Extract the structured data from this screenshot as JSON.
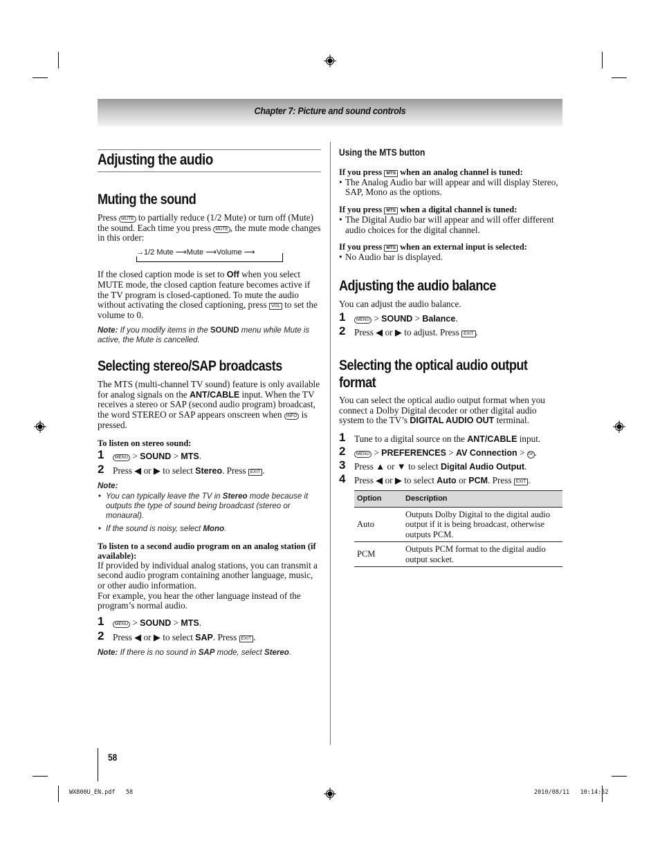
{
  "header": {
    "chapter_title": "Chapter 7: Picture and sound controls"
  },
  "left_column": {
    "page_title": "Adjusting the audio",
    "muting": {
      "heading": "Muting the sound",
      "p1_a": "Press",
      "p1_b": "to partially reduce (1/2 Mute) or turn off (Mute) the sound. Each time you press",
      "p1_c": ", the mute mode changes in this order:",
      "cycle": [
        "1/2 Mute",
        "Mute",
        "Volume"
      ],
      "p2_a": "If the closed caption mode is set to",
      "p2_bold": "Off",
      "p2_b": "when you select MUTE mode, the closed caption feature becomes active if the TV program is closed-captioned. To mute the audio without activating the closed captioning, press",
      "p2_c": "to set the volume to 0.",
      "note_label": "Note:",
      "note_a": "If you modify items in the",
      "note_bold": "SOUND",
      "note_b": "menu while Mute is active, the Mute is cancelled."
    },
    "stereo": {
      "heading": "Selecting stereo/SAP broadcasts",
      "p1_a": "The MTS (multi-channel TV sound) feature is only available for analog signals on the",
      "p1_bold": "ANT/CABLE",
      "p1_b": "input. When the TV receives a stereo or SAP (second audio program) broadcast, the word STEREO or SAP appears onscreen when",
      "p1_c": "is pressed.",
      "sub1": "To listen on stereo sound:",
      "steps1": [
        {
          "num": "1",
          "sound": "SOUND",
          "mts": "MTS"
        },
        {
          "num": "2",
          "a": "Press ◀ or ▶ to select",
          "bold": "Stereo",
          "b": ". Press",
          "c": "."
        }
      ],
      "note_label": "Note:",
      "notes": [
        {
          "a": "You can typically leave the TV in",
          "bold": "Stereo",
          "b": "mode because it outputs the type of sound being broadcast (stereo or monaural)."
        },
        {
          "a": "If the sound is noisy, select",
          "bold": "Mono",
          "b": "."
        }
      ],
      "sub2": "To listen to a second audio program on an analog station (if available):",
      "p2": "If provided by individual analog stations, you can transmit a second audio program containing another language, music, or other audio information.",
      "p3": "For example, you hear the other language instead of the program’s normal audio.",
      "steps2": [
        {
          "num": "1",
          "sound": "SOUND",
          "mts": "MTS"
        },
        {
          "num": "2",
          "a": "Press ◀ or ▶ to select",
          "bold": "SAP",
          "b": ". Press",
          "c": "."
        }
      ],
      "note2_label": "Note:",
      "note2_a": "If there is no sound in",
      "note2_bold1": "SAP",
      "note2_b": "mode, select",
      "note2_bold2": "Stereo",
      "note2_c": "."
    }
  },
  "right_column": {
    "mts": {
      "heading": "Using the MTS button",
      "items": [
        {
          "cond_a": "If you press",
          "cond_b": "when an analog channel is tuned:",
          "bullet": "The Analog Audio bar will appear and will display Stereo, SAP, Mono as the options."
        },
        {
          "cond_a": "If you press",
          "cond_b": "when a digital channel is tuned:",
          "bullet": "The Digital Audio bar will appear and will offer different audio choices for the digital channel."
        },
        {
          "cond_a": "If you press",
          "cond_b": "when an external input is selected:",
          "bullet": "No Audio bar is displayed."
        }
      ]
    },
    "balance": {
      "heading": "Adjusting the audio balance",
      "intro": "You can adjust the audio balance.",
      "step1": {
        "num": "1",
        "sound": "SOUND",
        "item": "Balance"
      },
      "step2": {
        "num": "2",
        "a": "Press ◀ or ▶ to adjust. Press",
        "b": "."
      }
    },
    "optical": {
      "heading_line1": "Selecting the optical audio output",
      "heading_line2": "format",
      "intro_a": "You can select the optical audio output format when you connect a Dolby Digital decoder or other digital audio system to the TV’s",
      "intro_bold": "DIGITAL AUDIO OUT",
      "intro_b": "terminal.",
      "step1": {
        "num": "1",
        "a": "Tune to a digital source on the",
        "bold": "ANT/CABLE",
        "b": "input."
      },
      "step2": {
        "num": "2",
        "pref": "PREFERENCES",
        "av": "AV Connection"
      },
      "step3": {
        "num": "3",
        "a": "Press ▲ or ▼ to select",
        "bold": "Digital Audio Output",
        "b": "."
      },
      "step4": {
        "num": "4",
        "a": "Press ◀ or ▶ to select",
        "bold1": "Auto",
        "or": "or",
        "bold2": "PCM",
        "b": ". Press",
        "c": "."
      },
      "table": {
        "headers": [
          "Option",
          "Description"
        ],
        "rows": [
          {
            "option": "Auto",
            "description": "Outputs Dolby Digital to the digital audio output if it is being broadcast, otherwise outputs PCM."
          },
          {
            "option": "PCM",
            "description": "Outputs PCM format to the digital audio output socket."
          }
        ]
      }
    }
  },
  "keys": {
    "mute": "MUTE",
    "vol": "VOL",
    "info": "INFO",
    "menu": "MENU",
    "exit": "EXIT",
    "mts": "MTS",
    "ok": "OK",
    "sep": ">"
  },
  "footer": {
    "page_number": "58",
    "file_info": "WX800U_EN.pdf   58",
    "timestamp": "2010/08/11   10:14:52"
  }
}
